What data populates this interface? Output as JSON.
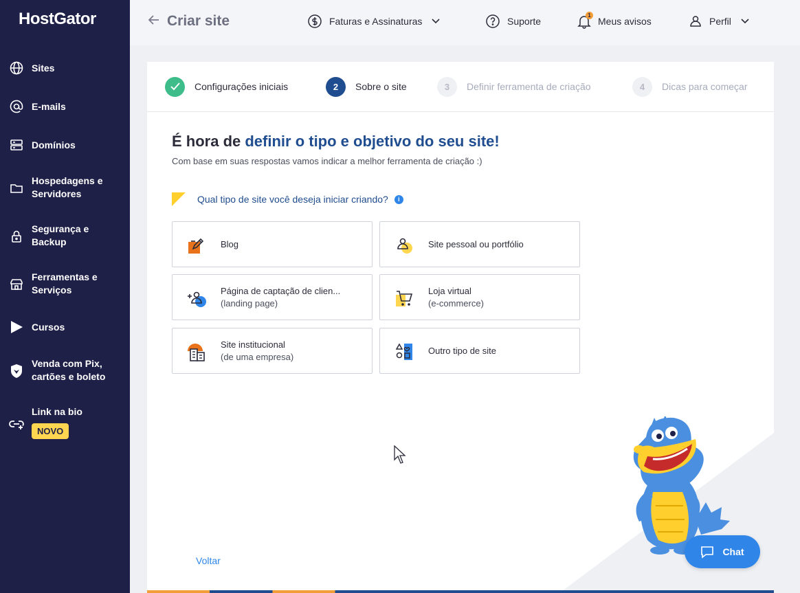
{
  "app": {
    "logo": "HostGator"
  },
  "sidebar": {
    "items": [
      {
        "label": "Sites",
        "icon": "globe-icon"
      },
      {
        "label": "E-mails",
        "icon": "at-icon"
      },
      {
        "label": "Domínios",
        "icon": "server-icon"
      },
      {
        "label": "Hospedagens e Servidores",
        "icon": "folder-icon"
      },
      {
        "label": "Segurança e Backup",
        "icon": "lock-icon"
      },
      {
        "label": "Ferramentas e Serviços",
        "icon": "store-icon"
      },
      {
        "label": "Cursos",
        "icon": "play-icon"
      },
      {
        "label": "Venda com Pix, cartões e boleto",
        "icon": "shield-icon"
      },
      {
        "label": "Link na bio",
        "icon": "link-icon"
      }
    ],
    "new_badge": "NOVO"
  },
  "header": {
    "title": "Criar site",
    "links": {
      "billing": "Faturas e Assinaturas",
      "support": "Suporte",
      "notices": "Meus avisos",
      "profile": "Perfil"
    },
    "notice_count": "1"
  },
  "stepper": {
    "steps": [
      {
        "number": "1",
        "label": "Configurações iniciais",
        "state": "done"
      },
      {
        "number": "2",
        "label": "Sobre o site",
        "state": "active"
      },
      {
        "number": "3",
        "label": "Definir ferramenta de criação",
        "state": "future"
      },
      {
        "number": "4",
        "label": "Dicas para começar",
        "state": "future"
      }
    ]
  },
  "main": {
    "headline_start": "É hora de ",
    "headline_accent": "definir o tipo e objetivo do seu site!",
    "subline": "Com base em suas respostas vamos indicar a melhor ferramenta de criação :)",
    "question": "Qual tipo de site você deseja iniciar criando?",
    "info": "i",
    "options": [
      {
        "line1": "Blog",
        "line2": "",
        "icon": "blog-edit-icon"
      },
      {
        "line1": "Site pessoal ou portfólio",
        "line2": "",
        "icon": "person-portfolio-icon"
      },
      {
        "line1": "Página de captação de clien...",
        "line2": "(landing page)",
        "icon": "add-user-icon"
      },
      {
        "line1": "Loja virtual",
        "line2": "(e-commerce)",
        "icon": "shopping-cart-icon"
      },
      {
        "line1": "Site institucional",
        "line2": "(de uma empresa)",
        "icon": "building-icon"
      },
      {
        "line1": "Outro tipo de site",
        "line2": "",
        "icon": "shapes-icon"
      }
    ],
    "back_label": "Voltar"
  },
  "chat": {
    "label": "Chat"
  },
  "colors": {
    "sidebar": "#1f2048",
    "accent_blue": "#1f4d8f",
    "link_blue": "#2f86e8",
    "success_green": "#3ebd8a",
    "badge_yellow": "#ffd64f",
    "orange": "#f29d38"
  }
}
